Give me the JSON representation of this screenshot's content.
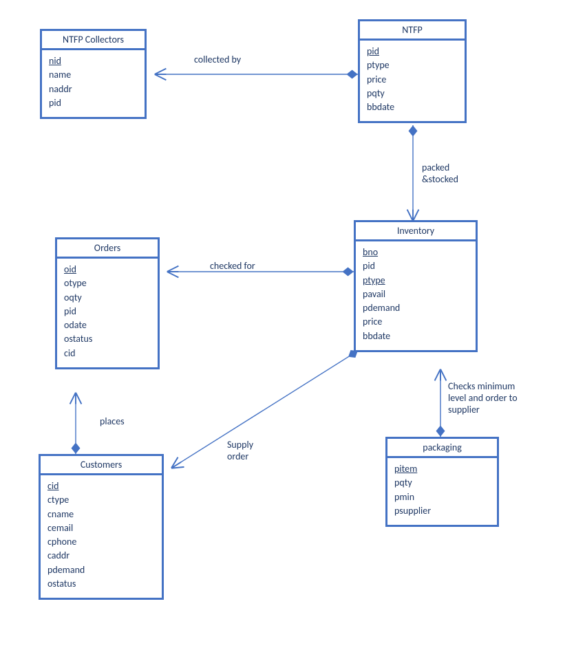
{
  "entities": {
    "ntfp_collectors": {
      "title": "NTFP Collectors",
      "attrs": [
        {
          "name": "nid",
          "pk": true
        },
        {
          "name": "name",
          "pk": false
        },
        {
          "name": "naddr",
          "pk": false
        },
        {
          "name": "pid",
          "pk": false
        }
      ]
    },
    "ntfp": {
      "title": "NTFP",
      "attrs": [
        {
          "name": "pid",
          "pk": true
        },
        {
          "name": "ptype",
          "pk": false
        },
        {
          "name": "price",
          "pk": false
        },
        {
          "name": "pqty",
          "pk": false
        },
        {
          "name": "bbdate",
          "pk": false
        }
      ]
    },
    "orders": {
      "title": "Orders",
      "attrs": [
        {
          "name": "oid",
          "pk": true
        },
        {
          "name": "otype",
          "pk": false
        },
        {
          "name": "oqty",
          "pk": false
        },
        {
          "name": "pid",
          "pk": false
        },
        {
          "name": "odate",
          "pk": false
        },
        {
          "name": "ostatus",
          "pk": false
        },
        {
          "name": "cid",
          "pk": false
        }
      ]
    },
    "inventory": {
      "title": "Inventory",
      "attrs": [
        {
          "name": "bno",
          "pk": true
        },
        {
          "name": "pid",
          "pk": false
        },
        {
          "name": "ptype",
          "pk": true
        },
        {
          "name": "pavail",
          "pk": false
        },
        {
          "name": "pdemand",
          "pk": false
        },
        {
          "name": "price",
          "pk": false
        },
        {
          "name": "bbdate",
          "pk": false
        }
      ]
    },
    "customers": {
      "title": "Customers",
      "attrs": [
        {
          "name": "cid",
          "pk": true
        },
        {
          "name": "ctype",
          "pk": false
        },
        {
          "name": "cname",
          "pk": false
        },
        {
          "name": "cemail",
          "pk": false
        },
        {
          "name": "cphone",
          "pk": false
        },
        {
          "name": "caddr",
          "pk": false
        },
        {
          "name": "pdemand",
          "pk": false
        },
        {
          "name": "ostatus",
          "pk": false
        }
      ]
    },
    "packaging": {
      "title": "packaging",
      "attrs": [
        {
          "name": "pitem",
          "pk": true
        },
        {
          "name": "pqty",
          "pk": false
        },
        {
          "name": "pmin",
          "pk": false
        },
        {
          "name": "psupplier",
          "pk": false
        }
      ]
    }
  },
  "relationships": {
    "collected_by": "collected by",
    "packed_stocked": "packed\n&stocked",
    "checked_for": "checked for",
    "places": "places",
    "supply_order": "Supply\norder",
    "checks_min_order": "Checks minimum\nlevel and order to\nsupplier"
  }
}
